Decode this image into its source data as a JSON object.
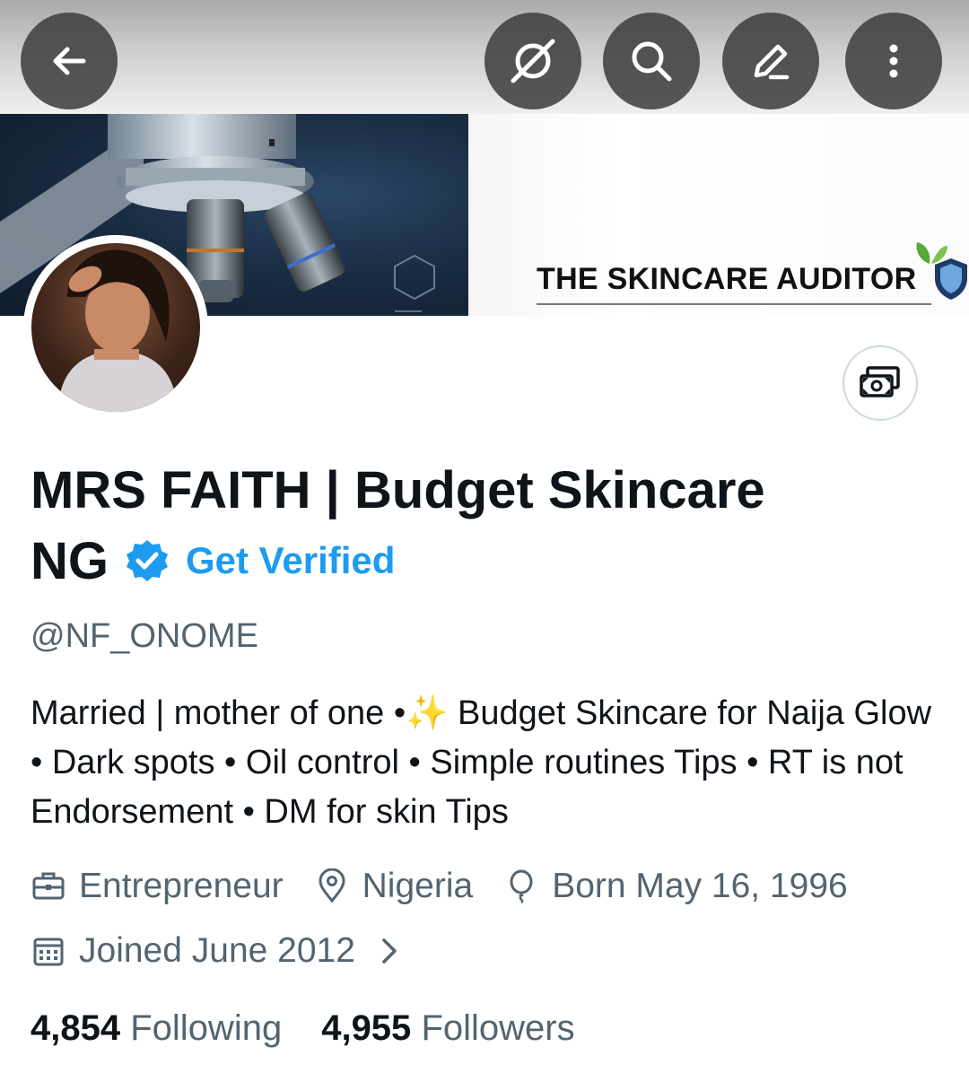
{
  "header": {
    "buttons": [
      "back-icon",
      "grok-icon",
      "search-icon",
      "edit-icon",
      "more-icon"
    ]
  },
  "banner": {
    "brand_text": "THE SKINCARE AUDITOR"
  },
  "profile": {
    "name_line1": "MRS FAITH | Budget Skincare",
    "name_line2": "NG",
    "get_verified": "Get Verified",
    "handle": "@NF_ONOME",
    "bio": "Married | mother of one •✨ Budget Skincare for Naija Glow • Dark spots • Oil control • Simple routines Tips • RT is not Endorsement • DM for skin Tips",
    "profession": "Entrepreneur",
    "location": "Nigeria",
    "birthday": "Born May 16, 1996",
    "joined": "Joined June 2012",
    "following_count": "4,854",
    "following_label": "Following",
    "followers_count": "4,955",
    "followers_label": "Followers"
  },
  "colors": {
    "accent": "#1d9bf0",
    "secondary_text": "#536471",
    "primary_text": "#0f1419"
  }
}
